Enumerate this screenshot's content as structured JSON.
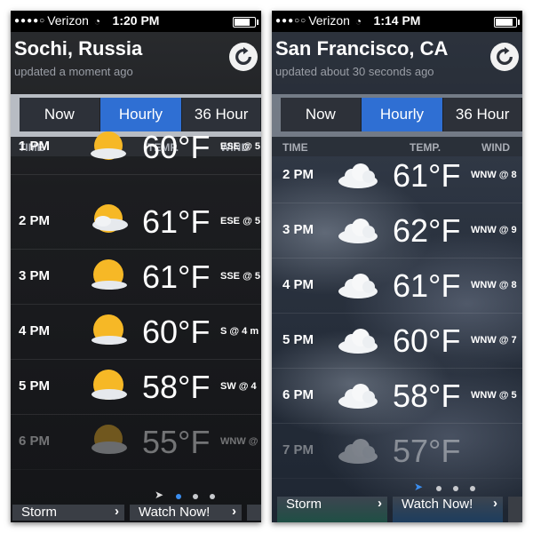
{
  "phones": [
    {
      "status": {
        "carrier": "Verizon",
        "time": "1:20 PM"
      },
      "city": "Sochi, Russia",
      "updated": "updated a moment ago",
      "tabs": [
        {
          "label": "Now"
        },
        {
          "label": "Hourly",
          "active": true
        },
        {
          "label": "36 Hour"
        }
      ],
      "columns": {
        "time": "TIME",
        "temp": "TEMP.",
        "wind": "WIND"
      },
      "rows": [
        {
          "time": "1 PM",
          "temp": "60°F",
          "wind": "ESE @ 5",
          "icon": "partly-sunny-icon"
        },
        {
          "time": "2 PM",
          "temp": "61°F",
          "wind": "ESE @ 5",
          "icon": "partly-sunny-icon"
        },
        {
          "time": "3 PM",
          "temp": "61°F",
          "wind": "SSE @ 5",
          "icon": "partly-sunny-icon"
        },
        {
          "time": "4 PM",
          "temp": "60°F",
          "wind": "S @ 4 m",
          "icon": "partly-sunny-icon"
        },
        {
          "time": "5 PM",
          "temp": "58°F",
          "wind": "SW @ 4",
          "icon": "partly-sunny-icon"
        },
        {
          "time": "6 PM",
          "temp": "55°F",
          "wind": "WNW @",
          "icon": "partly-sunny-icon"
        }
      ],
      "page_dots": 3,
      "active_dot": 0,
      "bottom": {
        "storm": "Storm",
        "watch": "Watch Now!"
      }
    },
    {
      "status": {
        "carrier": "Verizon",
        "time": "1:14 PM"
      },
      "city": "San Francisco, CA",
      "updated": "updated about 30 seconds ago",
      "tabs": [
        {
          "label": "Now"
        },
        {
          "label": "Hourly",
          "active": true
        },
        {
          "label": "36 Hour"
        }
      ],
      "columns": {
        "time": "TIME",
        "temp": "TEMP.",
        "wind": "WIND"
      },
      "rows": [
        {
          "time": "2 PM",
          "temp": "61°F",
          "wind": "WNW @ 8",
          "icon": "cloud-icon"
        },
        {
          "time": "3 PM",
          "temp": "62°F",
          "wind": "WNW @ 9",
          "icon": "cloud-icon"
        },
        {
          "time": "4 PM",
          "temp": "61°F",
          "wind": "WNW @ 8",
          "icon": "cloud-icon"
        },
        {
          "time": "5 PM",
          "temp": "60°F",
          "wind": "WNW @ 7",
          "icon": "cloud-icon"
        },
        {
          "time": "6 PM",
          "temp": "58°F",
          "wind": "WNW @ 5",
          "icon": "cloud-icon"
        },
        {
          "time": "7 PM",
          "temp": "57°F",
          "wind": "",
          "icon": "cloud-icon"
        }
      ],
      "page_dots": 3,
      "active_dot": -1,
      "bottom": {
        "storm": "Storm",
        "watch": "Watch Now!"
      }
    }
  ],
  "colors": {
    "accent": "#2f6fd3",
    "page_dot_active": "#3b8ef0"
  }
}
